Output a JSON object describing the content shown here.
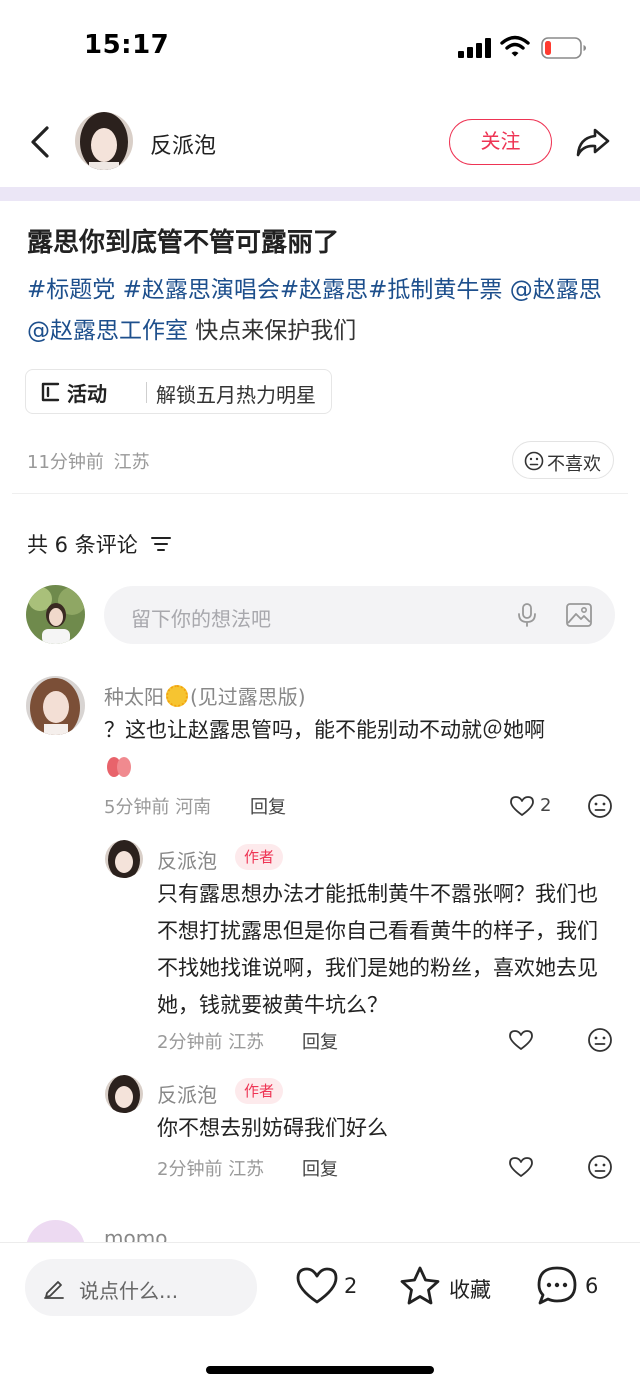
{
  "status_bar": {
    "time": "15:17"
  },
  "header": {
    "author_name": "反派泡",
    "follow_label": "关注"
  },
  "post": {
    "title": "露思你到底管不管可露丽了",
    "body_segments": [
      {
        "text": "#标题党 ",
        "tag": true
      },
      {
        "text": "#赵露思演唱会",
        "tag": true
      },
      {
        "text": "#赵露思",
        "tag": true
      },
      {
        "text": "#抵制黄牛票 ",
        "tag": true
      },
      {
        "text": "@赵露思 ",
        "tag": true
      },
      {
        "text": "@赵露思工作室",
        "tag": true
      },
      {
        "text": " 快点来保护我们",
        "tag": false
      }
    ],
    "activity": {
      "label": "活动",
      "text": "解锁五月热力明星"
    },
    "time": "11分钟前",
    "location": "江苏",
    "dislike_label": "不喜欢"
  },
  "comments_section": {
    "count_label": "共 6 条评论",
    "composer_placeholder": "留下你的想法吧"
  },
  "comments": [
    {
      "name": "种太阳",
      "name_suffix": "(见过露思版)",
      "text": "？这也让赵露思管吗，能不能别动不动就＠她啊",
      "time": "5分钟前",
      "location": "河南",
      "reply_label": "回复",
      "likes": "2"
    },
    {
      "name": "反派泡",
      "badge": "作者",
      "text": "只有露思想办法才能抵制黄牛不嚣张啊？我们也不想打扰露思但是你自己看看黄牛的样子，我们不找她找谁说啊，我们是她的粉丝，喜欢她去见她，钱就要被黄牛坑么？",
      "time": "2分钟前",
      "location": "江苏",
      "reply_label": "回复"
    },
    {
      "name": "反派泡",
      "badge": "作者",
      "text": "你不想去别妨碍我们好么",
      "time": "2分钟前",
      "location": "江苏",
      "reply_label": "回复"
    },
    {
      "name": "momo"
    }
  ],
  "bottom_bar": {
    "input_placeholder": "说点什么...",
    "likes": "2",
    "collect_label": "收藏",
    "comments": "6"
  },
  "colors": {
    "accent": "#ee3454",
    "tag": "#1d4f8c",
    "band": "#ebe6f6"
  }
}
